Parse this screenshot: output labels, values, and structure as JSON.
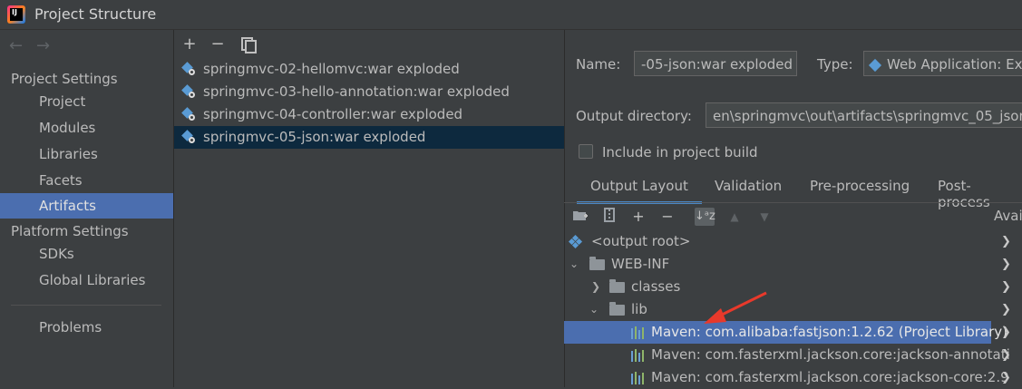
{
  "window": {
    "title": "Project Structure",
    "app_icon_text": "IJ"
  },
  "nav": {
    "back": "←",
    "forward": "→"
  },
  "sidebar": {
    "project_settings_header": "Project Settings",
    "project_items": [
      "Project",
      "Modules",
      "Libraries",
      "Facets",
      "Artifacts"
    ],
    "platform_settings_header": "Platform Settings",
    "platform_items": [
      "SDKs",
      "Global Libraries"
    ],
    "problems": "Problems",
    "selected": "Artifacts"
  },
  "artifacts_toolbar": {
    "add": "+",
    "remove": "−"
  },
  "artifacts": [
    "springmvc-02-hellomvc:war exploded",
    "springmvc-03-hello-annotation:war exploded",
    "springmvc-04-controller:war exploded",
    "springmvc-05-json:war exploded"
  ],
  "details": {
    "name_label": "Name:",
    "name_value": "-05-json:war exploded",
    "type_label": "Type:",
    "type_value": "Web Application: Ex",
    "output_dir_label": "Output directory:",
    "output_dir_value": "en\\springmvc\\out\\artifacts\\springmvc_05_json_",
    "include_label": "Include in project build",
    "include_checked": false
  },
  "tabs": [
    "Output Layout",
    "Validation",
    "Pre-processing",
    "Post-process"
  ],
  "active_tab": "Output Layout",
  "layout_toolbar": {
    "add": "+",
    "remove": "−",
    "sort": "↓ᵃz",
    "up": "▲",
    "down": "▼"
  },
  "available_label": "Avai",
  "tree": {
    "output_root": "<output root>",
    "web_inf": "WEB-INF",
    "classes": "classes",
    "lib": "lib",
    "libs": [
      "Maven: com.alibaba:fastjson:1.2.62 (Project Library)",
      "Maven: com.fasterxml.jackson.core:jackson-annotati",
      "Maven: com.fasterxml.jackson.core:jackson-core:2.9"
    ]
  },
  "colors": {
    "background": "#3c3f41",
    "selection": "#4b6eaf",
    "list_selection": "#0d293e",
    "annotation_arrow": "#e8392b"
  }
}
